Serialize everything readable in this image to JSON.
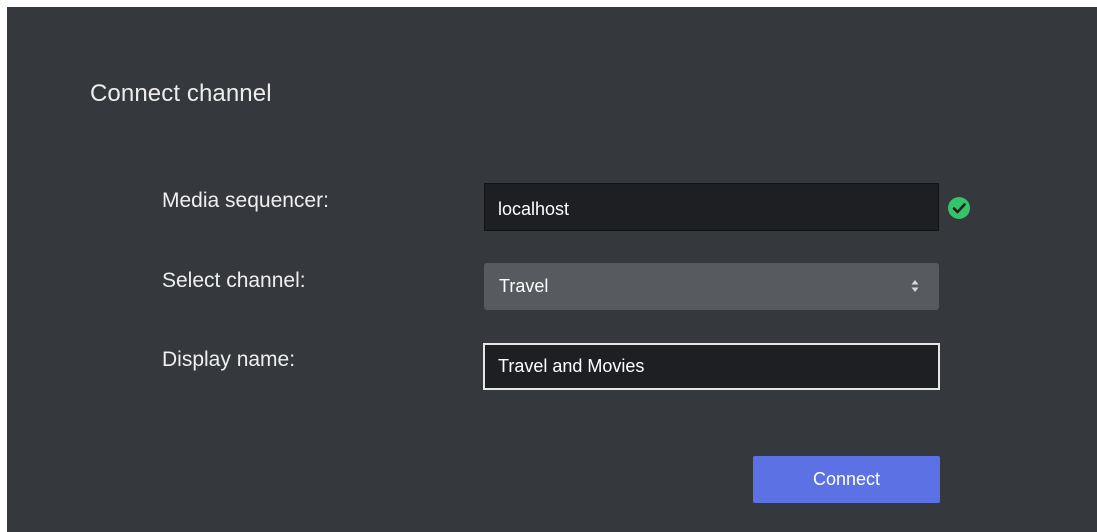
{
  "dialog": {
    "title": "Connect channel"
  },
  "form": {
    "media_sequencer": {
      "label": "Media sequencer:",
      "value": "localhost",
      "status_icon": "check-circle-icon",
      "status_color": "#35c468"
    },
    "channel": {
      "label": "Select channel:",
      "selected": "Travel"
    },
    "display_name": {
      "label": "Display name:",
      "value": "Travel and Movies"
    }
  },
  "actions": {
    "connect_label": "Connect",
    "connect_color": "#5c72e4"
  }
}
